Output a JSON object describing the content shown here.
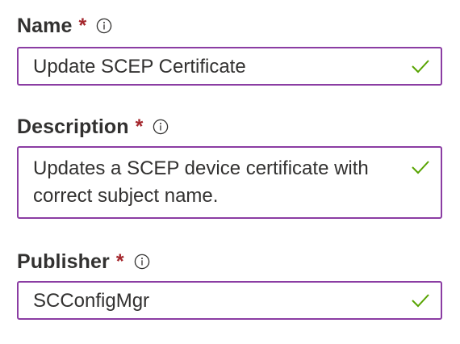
{
  "fields": [
    {
      "label": "Name",
      "required_mark": "*",
      "value": "Update SCEP Certificate",
      "icon": "info-icon",
      "status_icon": "checkmark-icon"
    },
    {
      "label": "Description",
      "required_mark": "*",
      "value": "Updates a SCEP device certificate with correct subject name.",
      "icon": "info-icon",
      "status_icon": "checkmark-icon"
    },
    {
      "label": "Publisher",
      "required_mark": "*",
      "value": "SCConfigMgr",
      "icon": "info-icon",
      "status_icon": "checkmark-icon"
    }
  ],
  "colors": {
    "input_border": "#8b3da3",
    "required": "#a4262c",
    "checkmark": "#57a300",
    "text": "#323130"
  }
}
